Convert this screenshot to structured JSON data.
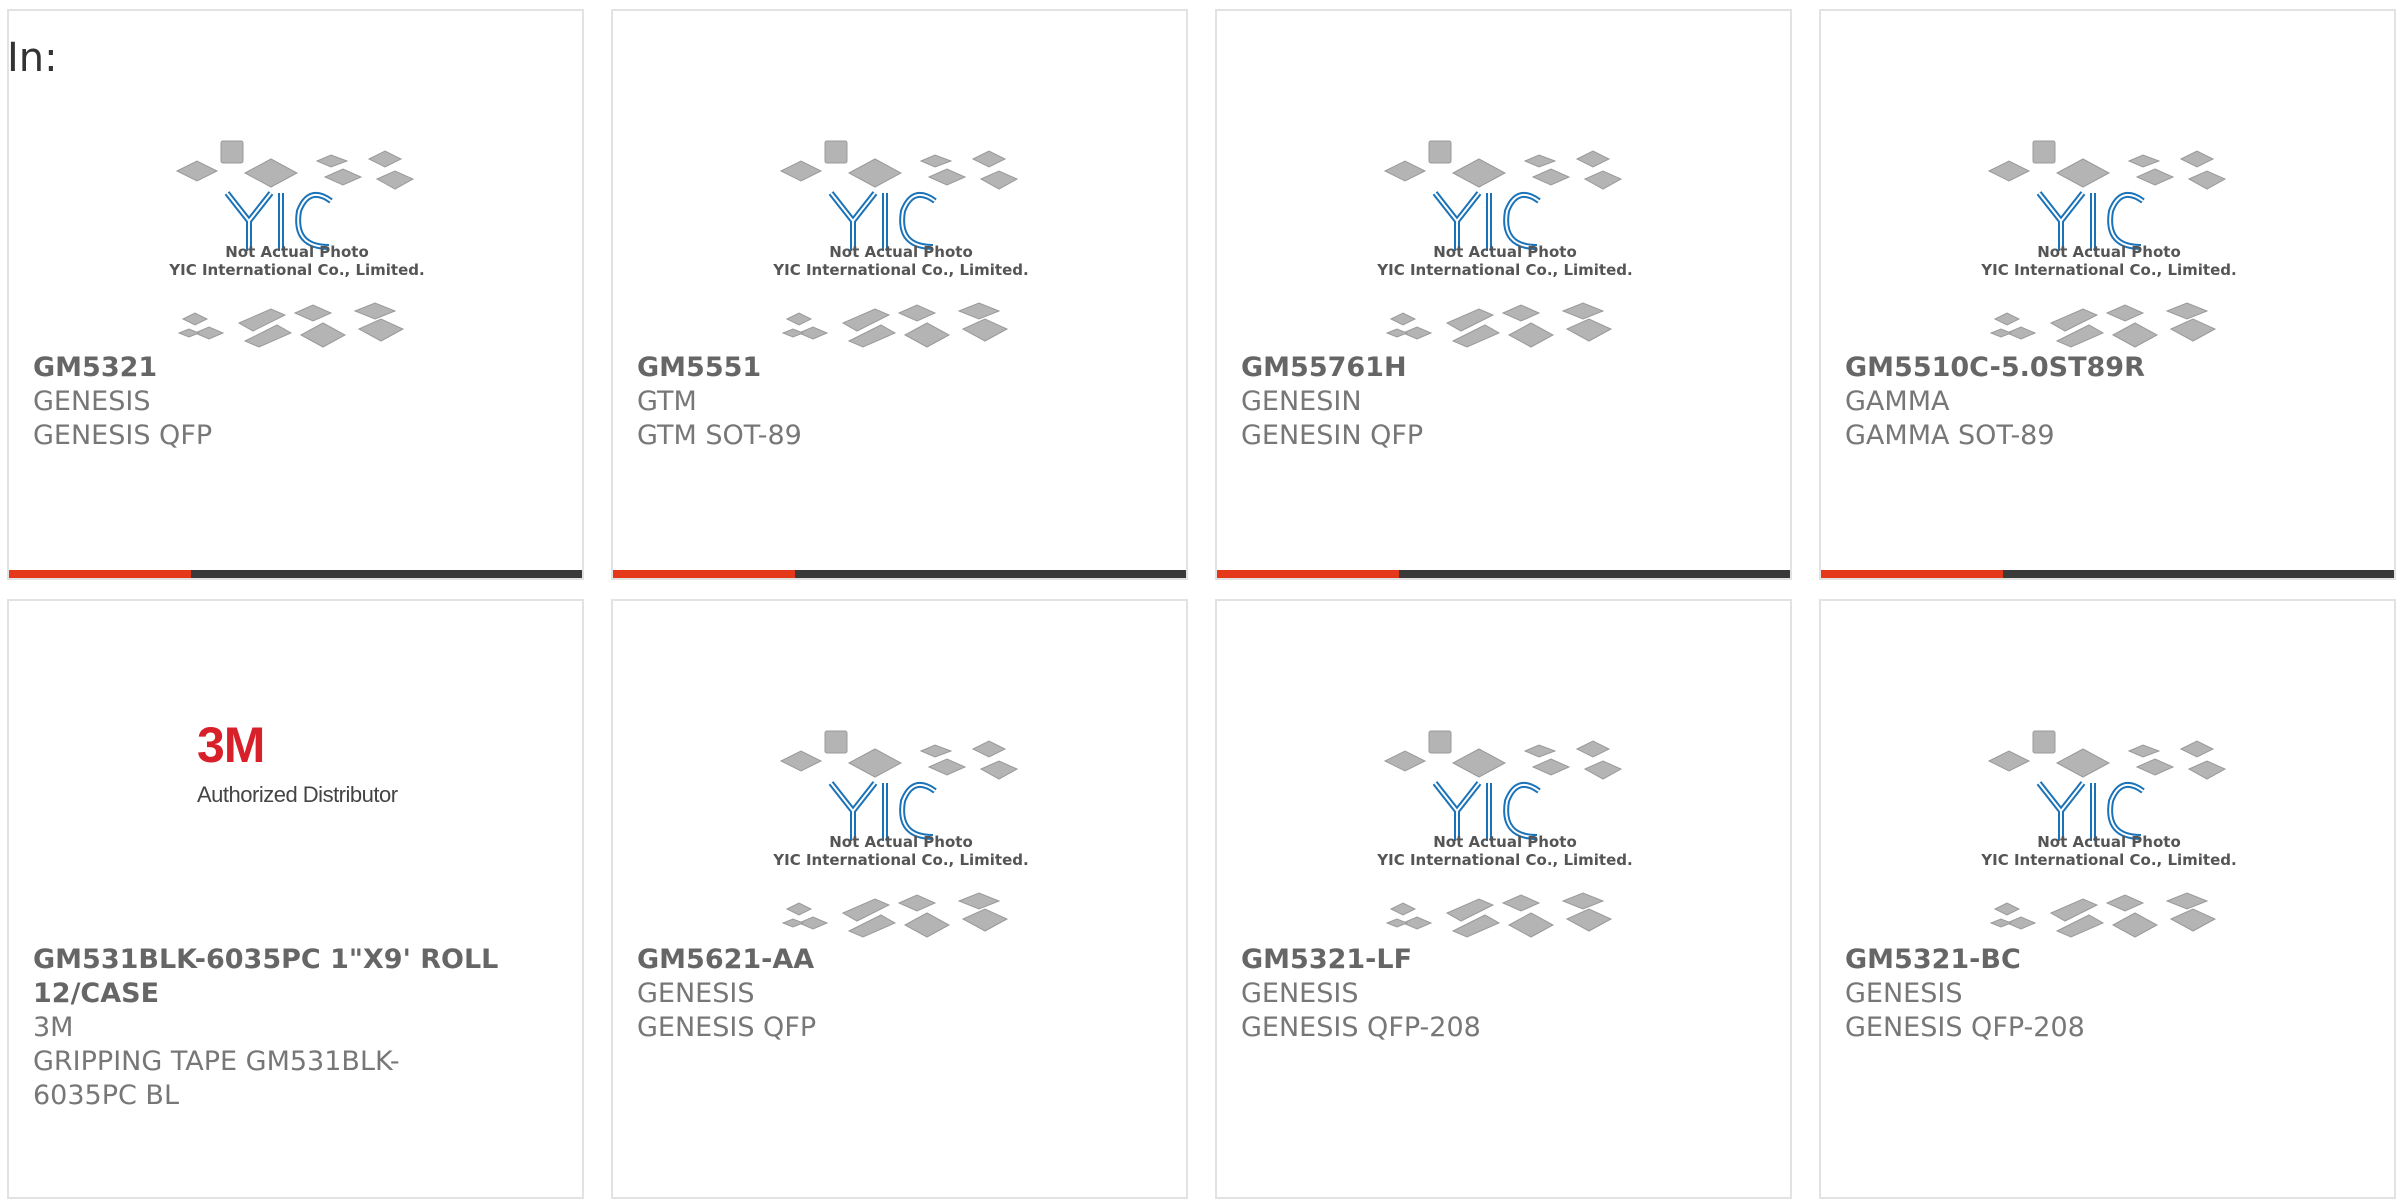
{
  "header": {
    "label": "In:"
  },
  "placeholder_image": {
    "logo_text": "YIC",
    "caption_line1": "Not Actual Photo",
    "caption_line2": "YIC International Co., Limited."
  },
  "distributor_image": {
    "brand": "3M",
    "tagline": "Authorized Distributor"
  },
  "colors": {
    "accent_bar": "#e5381a",
    "bar_dark": "#3a3a3a",
    "logo_blue": "#1a73b8"
  },
  "products": [
    {
      "part_number": "GM5321",
      "manufacturer": "GENESIS",
      "description": "GENESIS QFP"
    },
    {
      "part_number": "GM5551",
      "manufacturer": "GTM",
      "description": "GTM SOT-89"
    },
    {
      "part_number": "GM55761H",
      "manufacturer": "GENESIN",
      "description": "GENESIN QFP"
    },
    {
      "part_number": "GM5510C-5.0ST89R",
      "manufacturer": "GAMMA",
      "description": "GAMMA SOT-89"
    },
    {
      "part_number": "GM531BLK-6035PC 1\"X9' ROLL 12/CASE",
      "manufacturer": "3M",
      "description": "GRIPPING TAPE GM531BLK-6035PC BL"
    },
    {
      "part_number": "GM5621-AA",
      "manufacturer": "GENESIS",
      "description": "GENESIS QFP"
    },
    {
      "part_number": "GM5321-LF",
      "manufacturer": "GENESIS",
      "description": "GENESIS QFP-208"
    },
    {
      "part_number": "GM5321-BC",
      "manufacturer": "GENESIS",
      "description": "GENESIS QFP-208"
    }
  ]
}
